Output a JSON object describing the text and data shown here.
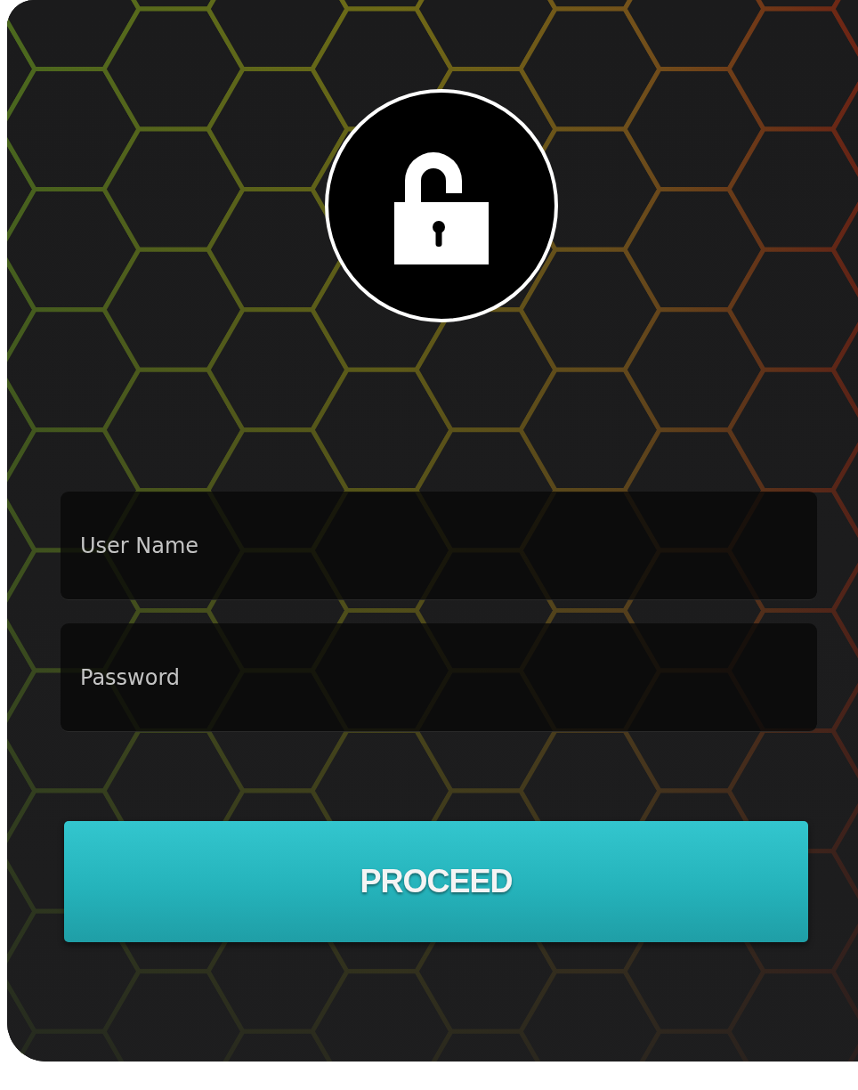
{
  "fields": [
    {
      "placeholder": "User Name"
    },
    {
      "placeholder": "Password"
    }
  ],
  "button": {
    "label": "PROCEED"
  }
}
